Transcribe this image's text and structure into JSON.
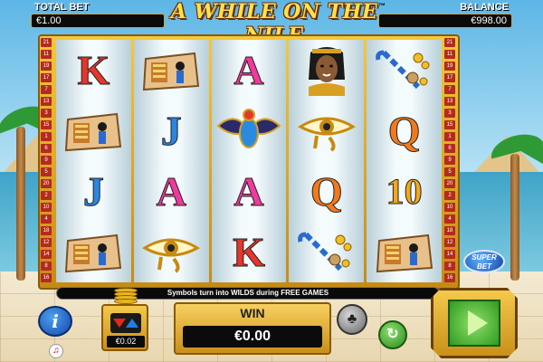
{
  "header": {
    "total_bet_label": "TOTAL BET",
    "total_bet_value": "€1.00",
    "title": "A WHILE ON THE NILE",
    "trademark": "™",
    "balance_label": "BALANCE",
    "balance_value": "€998.00"
  },
  "paylines": {
    "left": [
      "21",
      "11",
      "19",
      "17",
      "7",
      "13",
      "3",
      "15",
      "1",
      "6",
      "9",
      "5",
      "20",
      "2",
      "10",
      "4",
      "18",
      "12",
      "14",
      "8",
      "16"
    ],
    "right": [
      "21",
      "11",
      "19",
      "17",
      "7",
      "13",
      "3",
      "15",
      "1",
      "6",
      "9",
      "5",
      "20",
      "2",
      "10",
      "4",
      "18",
      "12",
      "14",
      "8",
      "16"
    ]
  },
  "reels": [
    [
      {
        "type": "letter",
        "text": "K",
        "cls": "K"
      },
      {
        "type": "icon",
        "icon": "pharaoh-tablet-icon"
      },
      {
        "type": "letter",
        "text": "J",
        "cls": "J"
      },
      {
        "type": "icon",
        "icon": "pharaoh-tablet-icon"
      }
    ],
    [
      {
        "type": "icon",
        "icon": "pharaoh-tablet-icon"
      },
      {
        "type": "letter",
        "text": "J",
        "cls": "J"
      },
      {
        "type": "letter",
        "text": "A",
        "cls": "A"
      },
      {
        "type": "icon",
        "icon": "eye-of-horus-icon"
      }
    ],
    [
      {
        "type": "letter",
        "text": "A",
        "cls": "A"
      },
      {
        "type": "icon",
        "icon": "scarab-icon"
      },
      {
        "type": "letter",
        "text": "A",
        "cls": "A"
      },
      {
        "type": "letter",
        "text": "K",
        "cls": "K"
      }
    ],
    [
      {
        "type": "icon",
        "icon": "cleopatra-icon"
      },
      {
        "type": "icon",
        "icon": "eye-of-horus-icon"
      },
      {
        "type": "letter",
        "text": "Q",
        "cls": "Q"
      },
      {
        "type": "icon",
        "icon": "cane-coins-icon"
      }
    ],
    [
      {
        "type": "icon",
        "icon": "cane-coins-icon"
      },
      {
        "type": "letter",
        "text": "Q",
        "cls": "Q"
      },
      {
        "type": "letter",
        "text": "10",
        "cls": "10"
      },
      {
        "type": "icon",
        "icon": "pharaoh-tablet-icon"
      }
    ]
  ],
  "message": "Symbols turn into WILDS during FREE GAMES",
  "controls": {
    "info_label": "i",
    "sound_icon": "♫",
    "stake_value": "€0.02",
    "win_label": "WIN",
    "win_value": "€0.00",
    "autoplay_icon": "♣",
    "replay_icon": "↻",
    "superbet_label_1": "SUPER",
    "superbet_label_2": "BET"
  },
  "colors": {
    "gold": "#f5c83a",
    "accent_green": "#2f9a20",
    "payline_red": "#b52a1e"
  }
}
